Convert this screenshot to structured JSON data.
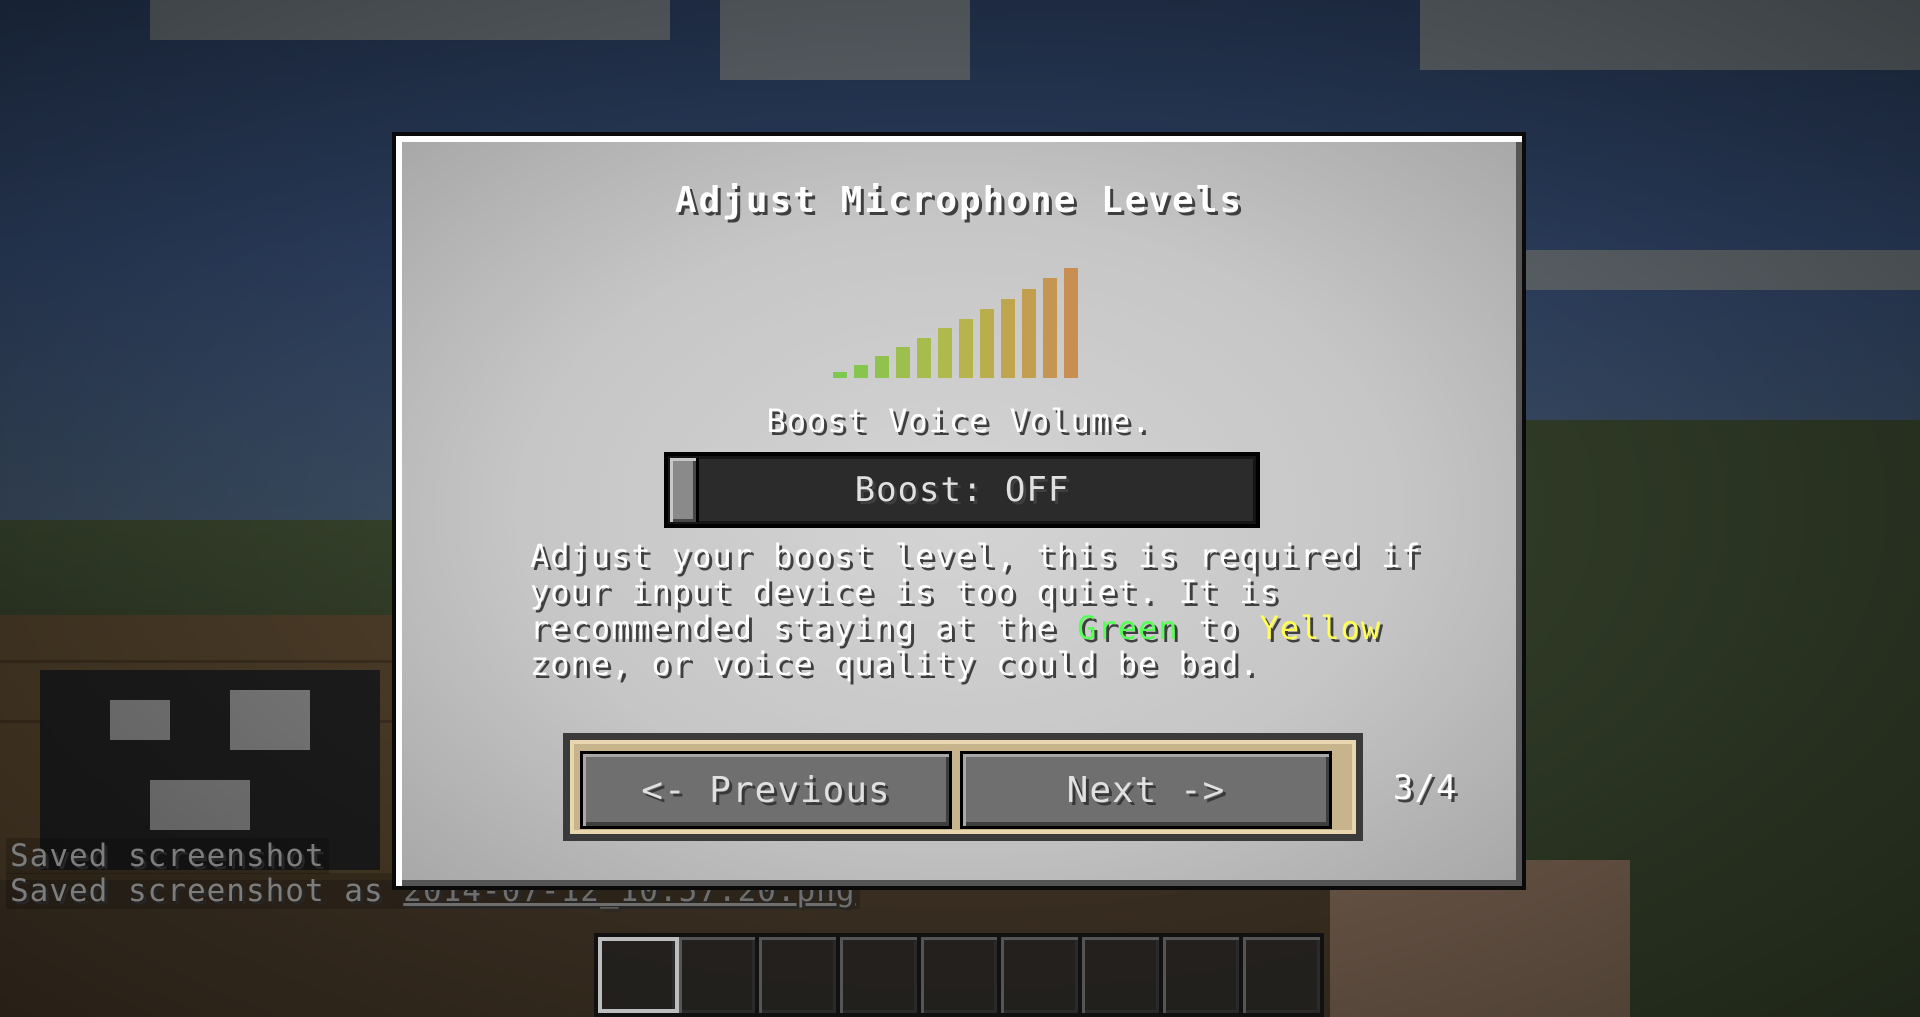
{
  "dialog": {
    "title": "Adjust Microphone Levels",
    "subtitle": "Boost Voice Volume.",
    "slider": {
      "label": "Boost: OFF",
      "value": 0
    },
    "description": {
      "line1": "Adjust your boost level, this is required if",
      "line2": "your input device is too quiet. It is",
      "line3_prefix": "recommended staying at the ",
      "green_word": "Green",
      "line3_mid": " to ",
      "yellow_word": "Yellow",
      "line4": "zone, or voice quality could be bad."
    },
    "buttons": {
      "previous": "<- Previous",
      "next": "Next ->"
    },
    "page_indicator": "3/4",
    "level_colors": [
      "#7ec850",
      "#b5b84a",
      "#c98f52"
    ]
  },
  "chat": {
    "line1": "Saved screenshot",
    "line2_prefix": "Saved screenshot as ",
    "line2_link": "2014-07-12_10.57.20.png"
  },
  "hotbar": {
    "slots": 9,
    "selected": 1
  }
}
